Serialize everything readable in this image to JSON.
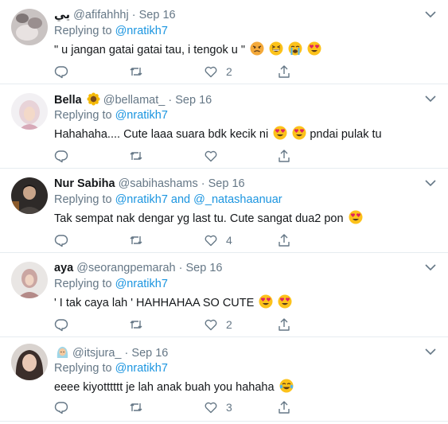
{
  "tweets": [
    {
      "name": "يي",
      "handle": "@afifahhhj",
      "sep": "·",
      "time": "Sep 16",
      "replying_prefix": "Replying to",
      "mentions": [
        "@nratikh7"
      ],
      "mention_joiner": "",
      "text": "\" u jangan gatai gatai tau, i tengok u \"",
      "emojis": [
        "angry-face",
        "grinning-squinting-face",
        "loudly-crying-face",
        "heart-eyes-face"
      ],
      "text_after": "",
      "reply_count": "",
      "retweet_count": "",
      "like_count": "2",
      "name_emoji": ""
    },
    {
      "name": "Bella",
      "handle": "@bellamat_",
      "sep": "·",
      "time": "Sep 16",
      "replying_prefix": "Replying to",
      "mentions": [
        "@nratikh7"
      ],
      "mention_joiner": "",
      "text": "Hahahaha.... Cute laaa suara bdk kecik ni",
      "emojis": [
        "heart-eyes-face",
        "heart-eyes-face"
      ],
      "text_after": "pndai pulak tu",
      "reply_count": "",
      "retweet_count": "",
      "like_count": "",
      "name_emoji": "sunflower"
    },
    {
      "name": "Nur Sabiha",
      "handle": "@sabihashams",
      "sep": "·",
      "time": "Sep 16",
      "replying_prefix": "Replying to",
      "mentions": [
        "@nratikh7",
        "@_natashaanuar"
      ],
      "mention_joiner": "and",
      "text": "Tak sempat nak dengar yg last tu. Cute sangat dua2 pon",
      "emojis": [
        "heart-eyes-face"
      ],
      "text_after": "",
      "reply_count": "",
      "retweet_count": "",
      "like_count": "4",
      "name_emoji": ""
    },
    {
      "name": "aya",
      "handle": "@seorangpemarah",
      "sep": "·",
      "time": "Sep 16",
      "replying_prefix": "Replying to",
      "mentions": [
        "@nratikh7"
      ],
      "mention_joiner": "",
      "text": "' I tak caya lah ' HAHHAHAA SO CUTE",
      "emojis": [
        "heart-eyes-face",
        "heart-eyes-face"
      ],
      "text_after": "",
      "reply_count": "",
      "retweet_count": "",
      "like_count": "2",
      "name_emoji": ""
    },
    {
      "name": "",
      "handle": "@itsjura_",
      "sep": "·",
      "time": "Sep 16",
      "replying_prefix": "Replying to",
      "mentions": [
        "@nratikh7"
      ],
      "mention_joiner": "",
      "text": "eeee kiyotttttt je lah anak buah you hahaha",
      "emojis": [
        "face-with-tears-of-joy"
      ],
      "text_after": "",
      "reply_count": "",
      "retweet_count": "",
      "like_count": "3",
      "name_emoji": "person-with-headscarf"
    }
  ],
  "colors": {
    "text": "#14171a",
    "muted": "#657786",
    "link": "#1b95e0",
    "divider": "#e6ecf0"
  }
}
